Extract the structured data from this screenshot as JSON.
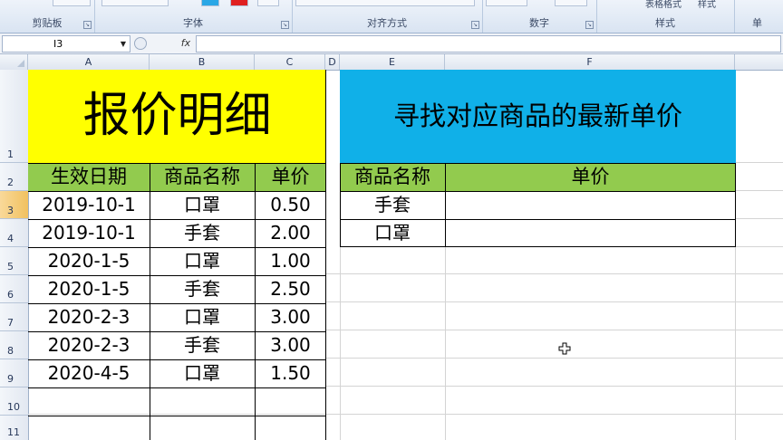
{
  "ribbon": {
    "groups": [
      {
        "label": "剪贴板"
      },
      {
        "label": "字体"
      },
      {
        "label": "对齐方式"
      },
      {
        "label": "数字"
      },
      {
        "label": "样式"
      },
      {
        "label": "单"
      }
    ],
    "table_format_label": "表格格式",
    "cell_style_label": "样式"
  },
  "formula_bar": {
    "name_box": "I3",
    "formula": ""
  },
  "columns": [
    "A",
    "B",
    "C",
    "D",
    "E",
    "F"
  ],
  "rows": [
    "1",
    "2",
    "3",
    "4",
    "5",
    "6",
    "7",
    "8",
    "9",
    "10",
    "11"
  ],
  "selected_row": "3",
  "left_table": {
    "title": "报价明细",
    "headers": [
      "生效日期",
      "商品名称",
      "单价"
    ],
    "rows": [
      [
        "2019-10-1",
        "口罩",
        "0.50"
      ],
      [
        "2019-10-1",
        "手套",
        "2.00"
      ],
      [
        "2020-1-5",
        "口罩",
        "1.00"
      ],
      [
        "2020-1-5",
        "手套",
        "2.50"
      ],
      [
        "2020-2-3",
        "口罩",
        "3.00"
      ],
      [
        "2020-2-3",
        "手套",
        "3.00"
      ],
      [
        "2020-4-5",
        "口罩",
        "1.50"
      ]
    ]
  },
  "right_table": {
    "title": "寻找对应商品的最新单价",
    "headers": [
      "商品名称",
      "单价"
    ],
    "rows": [
      [
        "手套",
        ""
      ],
      [
        "口罩",
        ""
      ]
    ]
  },
  "colors": {
    "title_yellow": "#ffff00",
    "title_blue": "#10b0e8",
    "header_green": "#92cb4e",
    "selected_row_header": "#f3c76c"
  },
  "cursor_icon": "cross-cursor-icon"
}
